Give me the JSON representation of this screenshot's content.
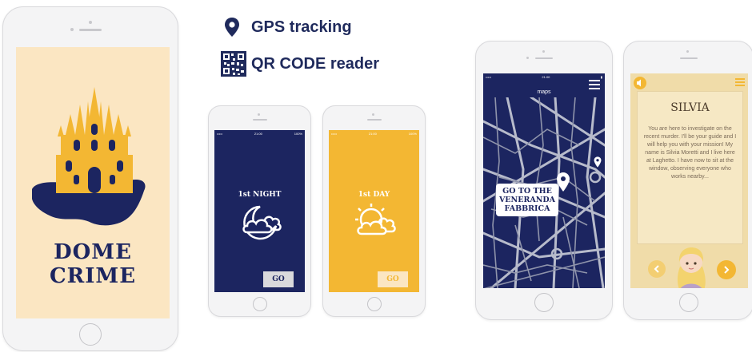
{
  "app": {
    "title": "DOME CRIME"
  },
  "features": [
    {
      "icon": "location-pin-icon",
      "label": "GPS tracking"
    },
    {
      "icon": "qr-code-icon",
      "label": "QR CODE reader"
    }
  ],
  "night_screen": {
    "title_prefix": "1st",
    "title_word": "NIGHT",
    "go_label": "GO",
    "time": "21:00",
    "battery": "100%"
  },
  "day_screen": {
    "title_prefix": "1st",
    "title_word": "DAY",
    "go_label": "GO",
    "time": "21:00",
    "battery": "100%"
  },
  "map_screen": {
    "header": "maps",
    "time": "21:00",
    "callout": "GO TO THE VENERANDA FABBRICA"
  },
  "story_screen": {
    "character": "SILVIA",
    "text": "You are here to investigate on the recent murder. I'll be your guide and I will help you with your mission! My name is Silvia Moretti and I live here at Laghetto. I have now to sit at the window, observing everyone who works nearby..."
  },
  "colors": {
    "navy": "#1c2560",
    "gold": "#f3b733",
    "cream": "#fbe6c2",
    "parchment": "#f3e2b8"
  }
}
